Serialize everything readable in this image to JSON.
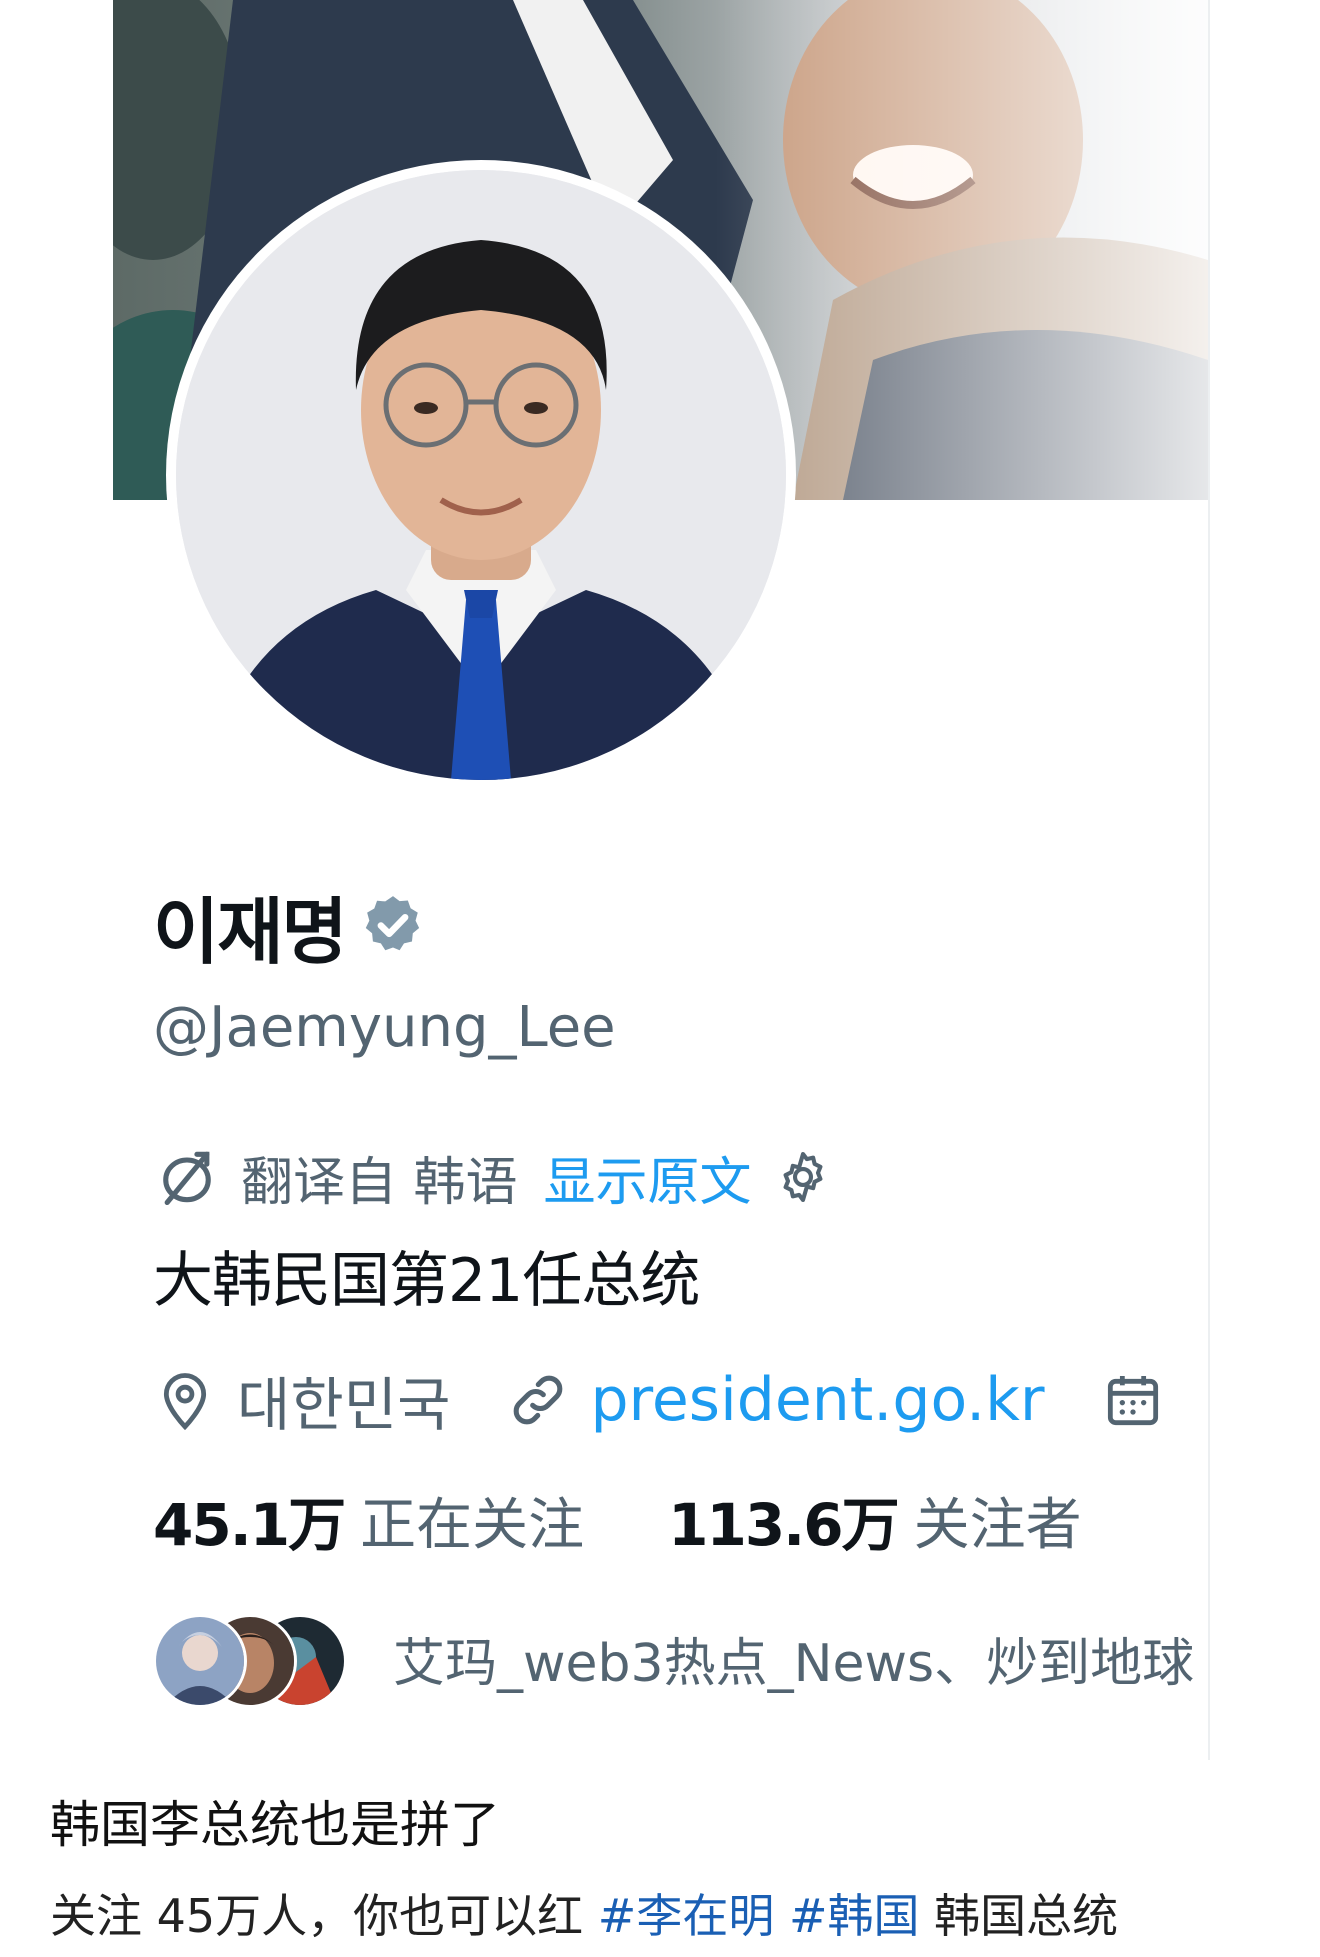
{
  "profile": {
    "display_name": "이재명",
    "handle": "@Jaemyung_Lee",
    "verified_icon": "verified-badge-icon",
    "translate": {
      "label": "翻译自 韩语",
      "action": "显示原文"
    },
    "bio": "大韩民国第21任总统",
    "location": "대한민국",
    "website": "president.go.kr",
    "following": {
      "count": "45.1万",
      "label": "正在关注"
    },
    "followers": {
      "count": "113.6万",
      "label": "关注者"
    },
    "followed_by_text": "艾玛_web3热点_News、炒到地球"
  },
  "post": {
    "title": "韩国李总统也是拼了",
    "body_prefix": "关注 45万人，你也可以红",
    "hashtags": [
      "#李在明",
      "#韩国"
    ],
    "body_suffix": "韩国总统"
  },
  "colors": {
    "link_blue": "#1d9bf0",
    "muted_gray": "#536471",
    "verified_gray": "#829aab",
    "hashtag_blue": "#1a5fb4"
  }
}
